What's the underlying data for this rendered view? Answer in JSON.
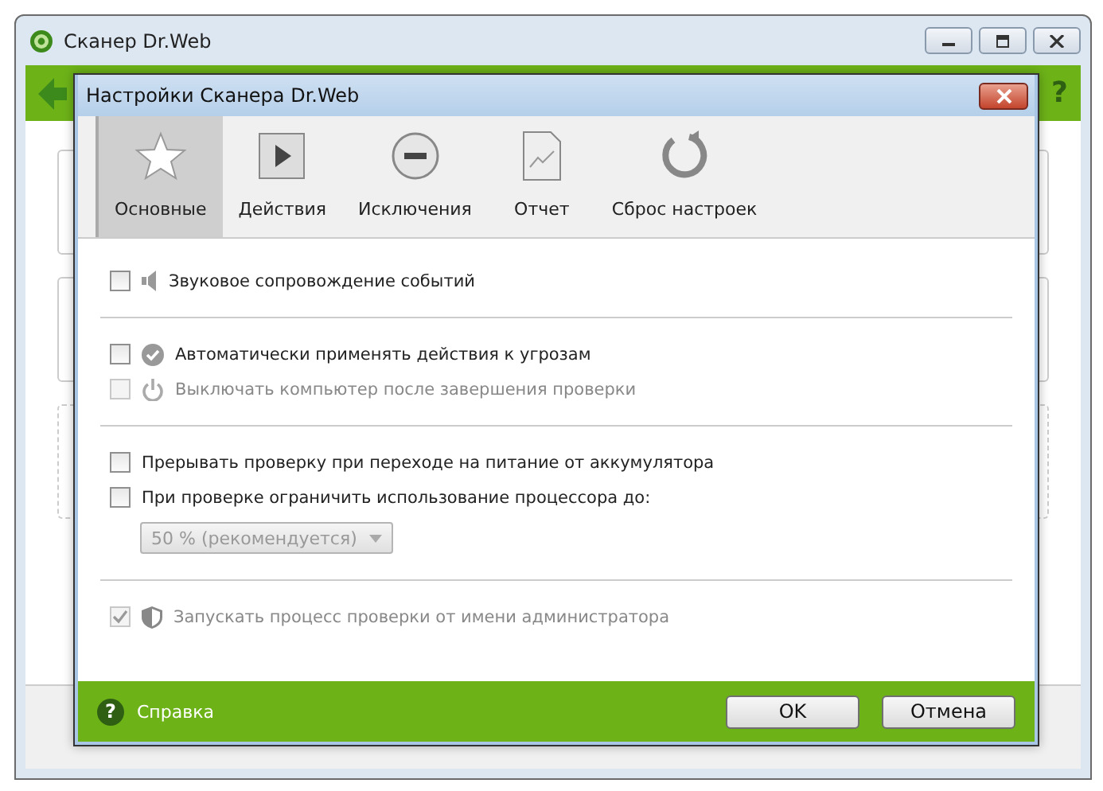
{
  "window": {
    "title": "Сканер Dr.Web",
    "help": "?"
  },
  "dialog": {
    "title": "Настройки Сканера Dr.Web",
    "tabs": [
      {
        "label": "Основные",
        "selected": true
      },
      {
        "label": "Действия",
        "selected": false
      },
      {
        "label": "Исключения",
        "selected": false
      },
      {
        "label": "Отчет",
        "selected": false
      },
      {
        "label": "Сброс настроек",
        "selected": false
      }
    ],
    "groups": [
      {
        "options": [
          {
            "kind": "checkbox",
            "label": "Звуковое сопровождение событий",
            "checked": false,
            "disabled": false
          }
        ]
      },
      {
        "options": [
          {
            "kind": "checkbox",
            "label": "Автоматически применять действия к угрозам",
            "checked": false,
            "disabled": false
          },
          {
            "kind": "checkbox",
            "label": "Выключать компьютер после завершения проверки",
            "checked": false,
            "disabled": true
          }
        ]
      },
      {
        "options": [
          {
            "kind": "checkbox",
            "label": "Прерывать проверку при переходе на питание от аккумулятора",
            "checked": false,
            "disabled": false
          },
          {
            "kind": "checkbox",
            "label": "При проверке ограничить использование процессора до:",
            "checked": false,
            "disabled": false
          },
          {
            "kind": "dropdown",
            "label": "50 % (рекомендуется)",
            "disabled": true
          }
        ]
      },
      {
        "options": [
          {
            "kind": "checkbox",
            "label": "Запускать процесс проверки от имени администратора",
            "checked": true,
            "disabled": true
          }
        ]
      }
    ],
    "help_icon": "?",
    "help": "Справка",
    "buttons": [
      "OK",
      "Отмена"
    ]
  }
}
